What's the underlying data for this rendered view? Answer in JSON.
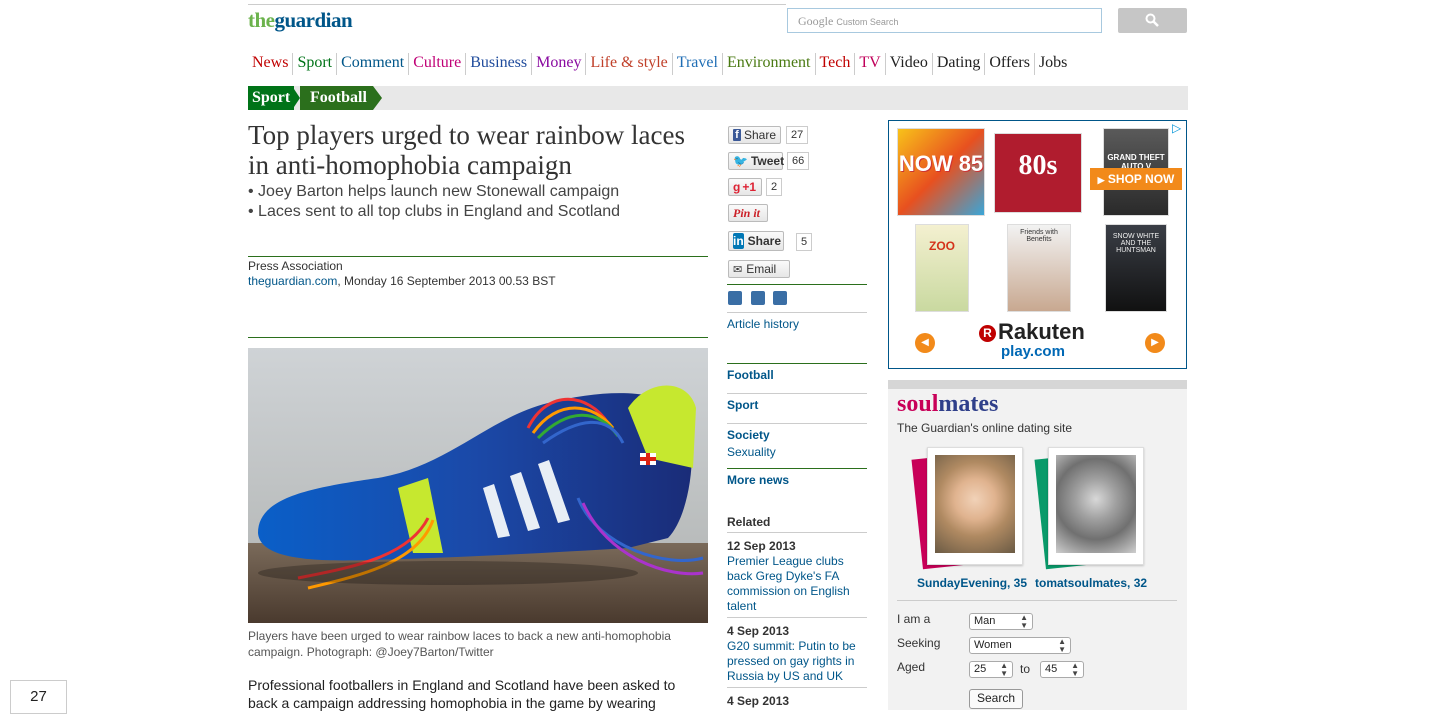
{
  "header": {
    "logo_the": "the",
    "logo_guardian": "guardian",
    "search_google": "Google",
    "search_placeholder": "Custom Search"
  },
  "nav": {
    "items": [
      {
        "label": "News",
        "color": "#c00000"
      },
      {
        "label": "Sport",
        "color": "#007318"
      },
      {
        "label": "Comment",
        "color": "#005689"
      },
      {
        "label": "Culture",
        "color": "#c00076"
      },
      {
        "label": "Business",
        "color": "#1f4b9c"
      },
      {
        "label": "Money",
        "color": "#8a0aa0"
      },
      {
        "label": "Life & style",
        "color": "#c0402a"
      },
      {
        "label": "Travel",
        "color": "#1f6eb5"
      },
      {
        "label": "Environment",
        "color": "#4a7a12"
      },
      {
        "label": "Tech",
        "color": "#c00000"
      },
      {
        "label": "TV",
        "color": "#c0005a"
      },
      {
        "label": "Video",
        "color": "#222222"
      },
      {
        "label": "Dating",
        "color": "#222222"
      },
      {
        "label": "Offers",
        "color": "#222222"
      },
      {
        "label": "Jobs",
        "color": "#222222"
      }
    ]
  },
  "breadcrumb": {
    "section": "Sport",
    "subsection": "Football"
  },
  "article": {
    "headline": "Top players urged to wear rainbow laces in anti-homophobia campaign",
    "standfirst": [
      "• Joey Barton helps launch new Stonewall campaign",
      "• Laces sent to all top clubs in England and Scotland"
    ],
    "author": "Press Association",
    "site": "theguardian.com",
    "dateline": ", Monday 16 September 2013 00.53 BST",
    "caption": "Players have been urged to wear rainbow laces to back a new anti-homophobia campaign. Photograph: @Joey7Barton/Twitter",
    "body": "Professional footballers in England and Scotland have been asked to back a campaign addressing homophobia in the game by wearing"
  },
  "share": {
    "facebook": {
      "label": "Share",
      "count": "27"
    },
    "twitter": {
      "label": "Tweet",
      "count": "66"
    },
    "gplus": {
      "label": "+1",
      "count": "2"
    },
    "pinterest": {
      "label": "Pin it"
    },
    "linkedin": {
      "label": "Share",
      "count": "5"
    },
    "email": {
      "label": "Email"
    },
    "article_history": "Article history"
  },
  "tags": {
    "football": "Football",
    "sport": "Sport",
    "society": "Society",
    "sexuality": "Sexuality",
    "more_news": "More news"
  },
  "related": {
    "heading": "Related",
    "items": [
      {
        "date": "12 Sep 2013",
        "title": "Premier League clubs back Greg Dyke's FA commission on English talent"
      },
      {
        "date": "4 Sep 2013",
        "title": "G20 summit: Putin to be pressed on gay rights in Russia by US and UK"
      },
      {
        "date": "4 Sep 2013",
        "title": ""
      }
    ]
  },
  "ad": {
    "shop_now": "SHOP NOW",
    "brand": "Rakuten",
    "brand_r": "R",
    "play": "play.com",
    "covers": [
      {
        "text": "NOW 85"
      },
      {
        "text": "80s"
      },
      {
        "text": "GRAND THEFT AUTO V"
      },
      {
        "text": "ZOO"
      },
      {
        "text": "Friends with Benefits"
      },
      {
        "text": "SNOW WHITE AND THE HUNTSMAN"
      }
    ]
  },
  "soulmates": {
    "logo_soul": "soul",
    "logo_mates": "mates",
    "tagline": "The Guardian's online dating site",
    "profiles": [
      {
        "name": "SundayEvening, 35"
      },
      {
        "name": "tomatsoulmates, 32"
      }
    ],
    "form": {
      "iam_label": "I am a",
      "iam_value": "Man",
      "seeking_label": "Seeking",
      "seeking_value": "Women",
      "aged_label": "Aged",
      "age_from": "25",
      "to_label": "to",
      "age_to": "45",
      "search_label": "Search"
    }
  },
  "counter": {
    "value": "27"
  }
}
